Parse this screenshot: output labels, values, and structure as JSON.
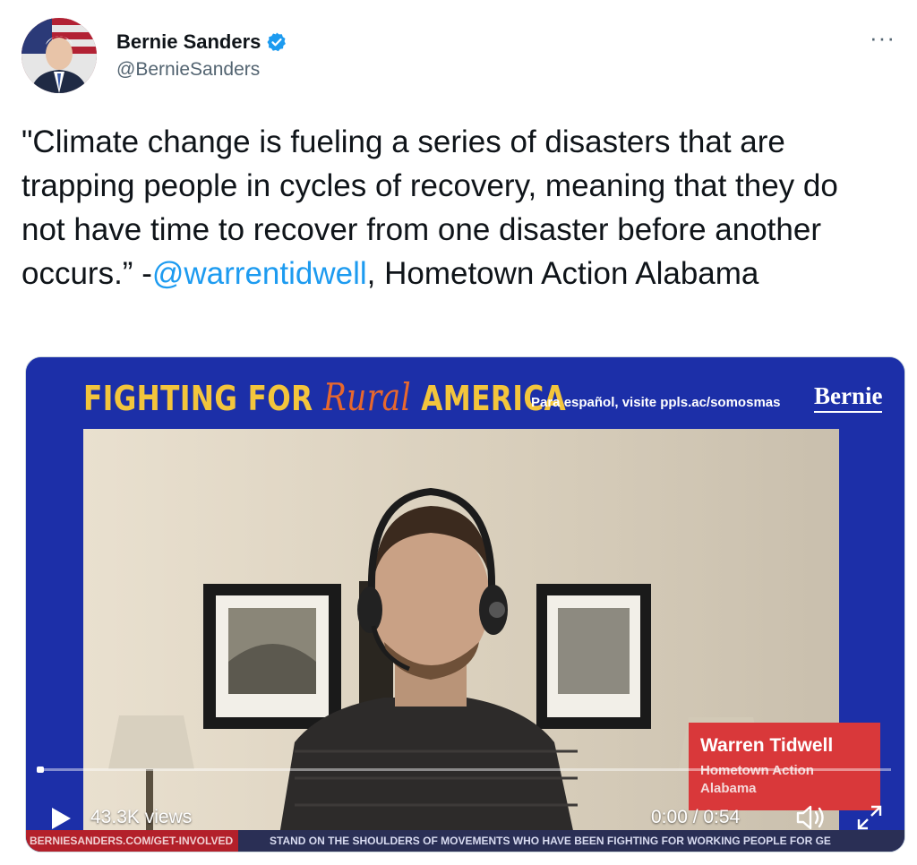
{
  "author": {
    "display_name": "Bernie Sanders",
    "handle": "@BernieSanders",
    "verified_icon": "verified-badge-icon",
    "avatar_icon": "profile-avatar"
  },
  "more_label": "···",
  "tweet": {
    "text_before": "\"Climate change is fueling a series of disasters that are trapping people in cycles of recovery, meaning that they do not have time to recover from one disaster before another occurs.” -",
    "mention": "@warrentidwell",
    "text_after": ", Hometown Action Alabama"
  },
  "video": {
    "banner_title_start": "FIGHTING FOR ",
    "banner_title_script": "Rural",
    "banner_title_end": " AMERICA",
    "banner_subtitle": "Para español, visite ppls.ac/somosmas",
    "banner_logo": "Bernie",
    "nameplate_name": "Warren Tidwell",
    "nameplate_org": "Hometown Action Alabama",
    "views": "43.3K views",
    "time": "0:00 / 0:54",
    "progress": 0.0,
    "ticker_tag": "BERNIESANDERS.COM/GET-INVOLVED",
    "ticker_text": "STAND ON THE SHOULDERS OF MOVEMENTS WHO HAVE BEEN FIGHTING FOR WORKING PEOPLE FOR GE"
  },
  "colors": {
    "link": "#1d9bf0",
    "verified": "#1d9bf0",
    "banner_bg": "#1c2fa8",
    "nameplate": "#d9383a",
    "title_yellow": "#f3c53c"
  }
}
